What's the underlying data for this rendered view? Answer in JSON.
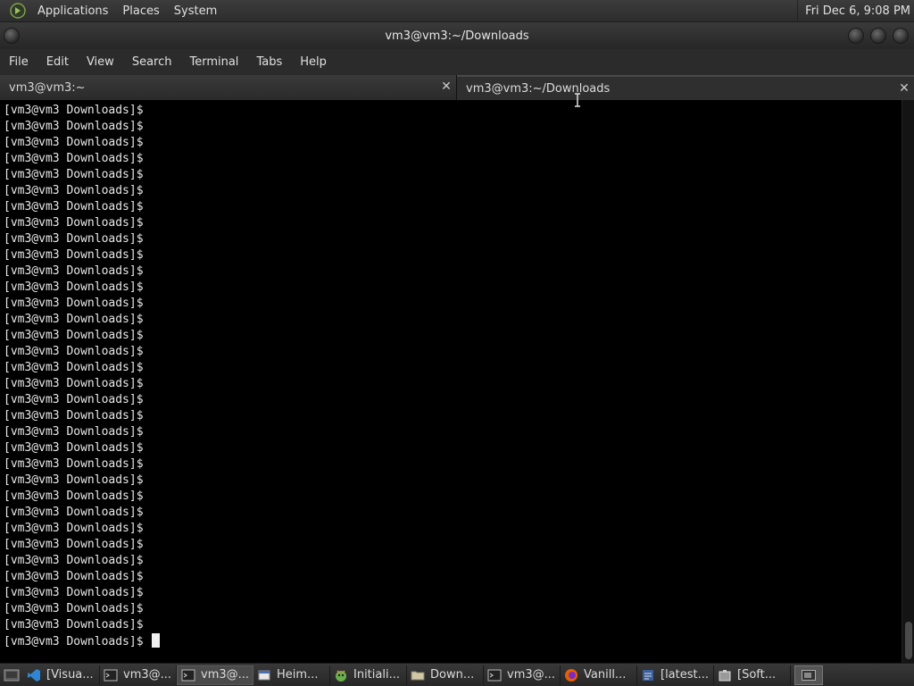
{
  "top_panel": {
    "menus": [
      "Applications",
      "Places",
      "System"
    ],
    "clock": "Fri Dec 6,  9:08 PM"
  },
  "window": {
    "title": "vm3@vm3:~/Downloads"
  },
  "menubar": {
    "items": [
      "File",
      "Edit",
      "View",
      "Search",
      "Terminal",
      "Tabs",
      "Help"
    ]
  },
  "tabs": [
    {
      "label": "vm3@vm3:~",
      "active": false
    },
    {
      "label": "vm3@vm3:~/Downloads",
      "active": true
    }
  ],
  "terminal": {
    "prompt": "[vm3@vm3 Downloads]$",
    "lines": [
      "[vm3@vm3 Downloads]$",
      "[vm3@vm3 Downloads]$",
      "[vm3@vm3 Downloads]$",
      "[vm3@vm3 Downloads]$",
      "[vm3@vm3 Downloads]$",
      "[vm3@vm3 Downloads]$",
      "[vm3@vm3 Downloads]$",
      "[vm3@vm3 Downloads]$",
      "[vm3@vm3 Downloads]$",
      "[vm3@vm3 Downloads]$",
      "[vm3@vm3 Downloads]$",
      "[vm3@vm3 Downloads]$",
      "[vm3@vm3 Downloads]$",
      "[vm3@vm3 Downloads]$",
      "[vm3@vm3 Downloads]$",
      "[vm3@vm3 Downloads]$",
      "[vm3@vm3 Downloads]$",
      "[vm3@vm3 Downloads]$",
      "[vm3@vm3 Downloads]$",
      "[vm3@vm3 Downloads]$",
      "[vm3@vm3 Downloads]$",
      "[vm3@vm3 Downloads]$",
      "[vm3@vm3 Downloads]$",
      "[vm3@vm3 Downloads]$",
      "[vm3@vm3 Downloads]$",
      "[vm3@vm3 Downloads]$",
      "[vm3@vm3 Downloads]$",
      "[vm3@vm3 Downloads]$",
      "[vm3@vm3 Downloads]$",
      "[vm3@vm3 Downloads]$",
      "[vm3@vm3 Downloads]$",
      "[vm3@vm3 Downloads]$",
      "[vm3@vm3 Downloads]$",
      "[vm3@vm3 Downloads]$"
    ]
  },
  "taskbar": {
    "tasks": [
      {
        "label": "[Visua...",
        "icon": "vscode-icon"
      },
      {
        "label": "vm3@...",
        "icon": "terminal-icon"
      },
      {
        "label": "vm3@...",
        "icon": "terminal-icon",
        "active": true
      },
      {
        "label": "Heim...",
        "icon": "document-icon"
      },
      {
        "label": "Initiali...",
        "icon": "installer-icon"
      },
      {
        "label": "Down...",
        "icon": "folder-icon"
      },
      {
        "label": "vm3@...",
        "icon": "terminal-icon"
      },
      {
        "label": "Vanill...",
        "icon": "firefox-icon"
      },
      {
        "label": "[latest...",
        "icon": "editor-icon"
      },
      {
        "label": "[Soft...",
        "icon": "package-icon"
      }
    ]
  }
}
